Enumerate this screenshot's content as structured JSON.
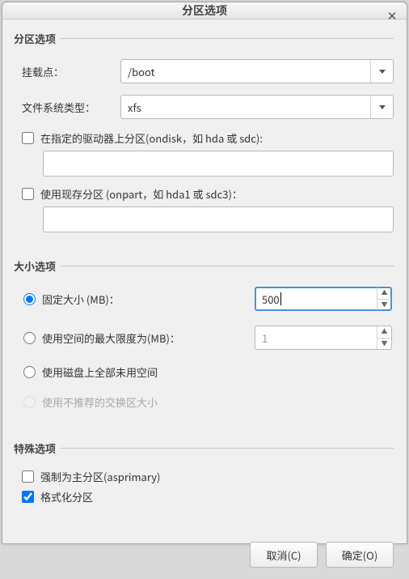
{
  "title": "分区选项",
  "section1": {
    "legend": "分区选项",
    "mountpoint_label": "挂载点：",
    "mountpoint_value": "/boot",
    "fstype_label": "文件系统类型：",
    "fstype_value": "xfs",
    "ondisk_label": "在指定的驱动器上分区(ondisk，如 hda 或 sdc):",
    "onpart_label": "使用现存分区 (onpart，如 hda1 或 sdc3)："
  },
  "section2": {
    "legend": "大小选项",
    "fixed_label": "固定大小 (MB)：",
    "fixed_value": "500",
    "max_label": "使用空间的最大限度为(MB)：",
    "max_value": "1",
    "all_label": "使用磁盘上全部未用空间",
    "swap_label": "使用不推荐的交换区大小"
  },
  "section3": {
    "legend": "特殊选项",
    "asprimary_label": "强制为主分区(asprimary)",
    "format_label": "格式化分区"
  },
  "buttons": {
    "cancel": "取消(C)",
    "ok": "确定(O)"
  }
}
